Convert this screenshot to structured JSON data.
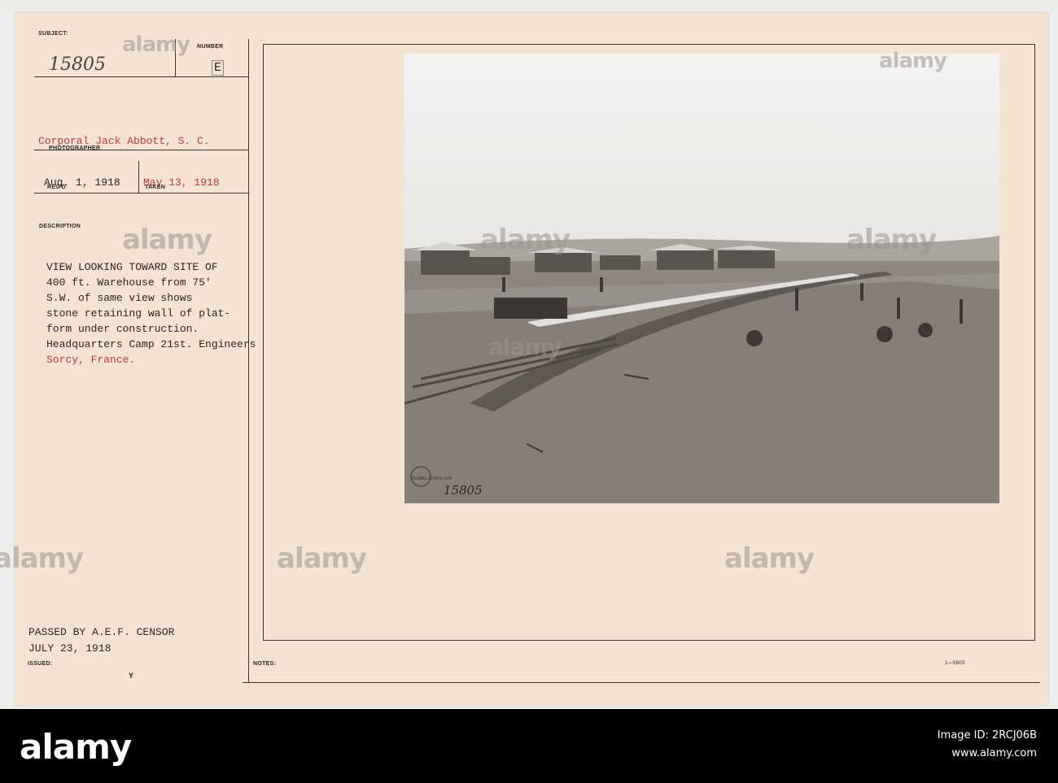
{
  "record": {
    "subject_label": "SUBJECT:",
    "subject_value": "15805",
    "number_label": "NUMBER",
    "number_value": "E",
    "photographer": "Corporal Jack Abbott, S. C.",
    "photographer_label": "PHOTOGRAPHER",
    "received_date": "Aug. 1, 1918",
    "received_label": "REC'D",
    "taken_date": "May 13, 1918",
    "taken_label": "TAKEN",
    "description_label": "DESCRIPTION",
    "description_lines": [
      "VIEW LOOKING TOWARD SITE OF",
      "400 ft. Warehouse from 75'",
      "S.W. of same view shows",
      "stone retaining wall of plat-",
      "form under construction.",
      "Headquarters Camp 21st. Engineers",
      "Sorcy, France."
    ],
    "censor_line1": "PASSED BY A.E.F. CENSOR",
    "censor_line2": "JULY 23, 1918",
    "issued_label": "ISSUED:",
    "issued_value": "Y",
    "notes_label": "NOTES:",
    "form_number": "1—5603"
  },
  "photo": {
    "stamp_text": "SIGNAL CORPS USA",
    "photo_number": "15805"
  },
  "watermarks": [
    "alamy",
    "alamy",
    "alamy",
    "alamy",
    "alamy",
    "alamy",
    "alamy",
    "alamy",
    "alamy"
  ],
  "footer": {
    "logo": "alamy",
    "image_id": "Image ID: 2RCJ06B",
    "url": "www.alamy.com"
  }
}
